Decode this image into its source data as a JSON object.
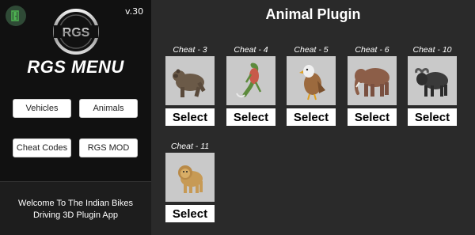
{
  "sidebar": {
    "version": "v.30",
    "logo_text": "RGS",
    "title": "RGS MENU",
    "buttons": {
      "vehicles": "Vehicles",
      "animals": "Animals",
      "cheat_codes": "Cheat Codes",
      "rgs_mod": "RGS MOD"
    },
    "welcome_line1": "Welcome To The Indian Bikes",
    "welcome_line2": "Driving 3D Plugin App"
  },
  "main": {
    "title": "Animal Plugin",
    "cards": [
      {
        "label": "Cheat - 3",
        "select": "Select",
        "animal": "bear"
      },
      {
        "label": "Cheat - 4",
        "select": "Select",
        "animal": "lizard-creature"
      },
      {
        "label": "Cheat - 5",
        "select": "Select",
        "animal": "eagle"
      },
      {
        "label": "Cheat - 6",
        "select": "Select",
        "animal": "elephant"
      },
      {
        "label": "Cheat - 10",
        "select": "Select",
        "animal": "buffalo"
      },
      {
        "label": "Cheat - 11",
        "select": "Select",
        "animal": "lion"
      }
    ]
  },
  "colors": {
    "sidebar_bg": "#111111",
    "main_bg": "#2a2a2a",
    "card_bg": "#c9c9c9",
    "exit_icon": "#4caf50"
  },
  "icons": {
    "exit": "exit-door-icon"
  }
}
